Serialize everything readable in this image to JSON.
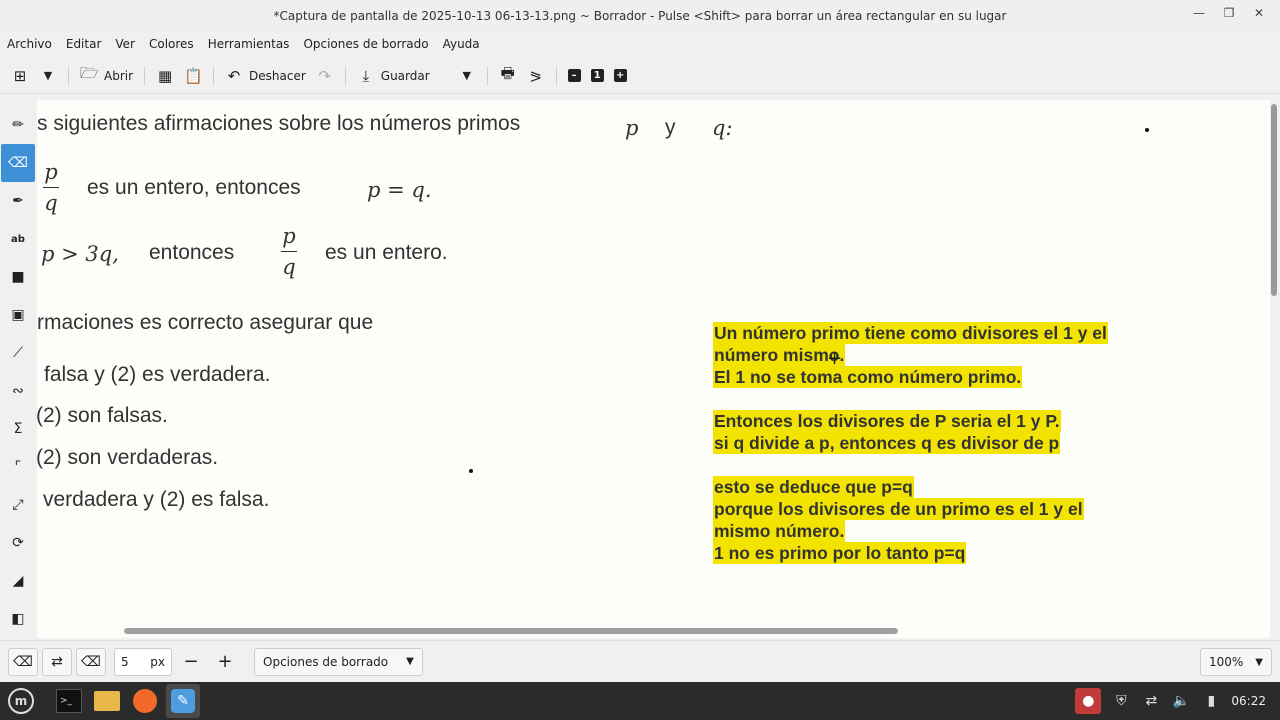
{
  "window": {
    "title": "*Captura de pantalla de 2025-10-13 06-13-13.png ~ Borrador - Pulse <Shift> para borrar un área rectangular en su lugar"
  },
  "menu": [
    "Archivo",
    "Editar",
    "Ver",
    "Colores",
    "Herramientas",
    "Opciones de borrado",
    "Ayuda"
  ],
  "toolbar": {
    "open_label": "Abrir",
    "undo_label": "Deshacer",
    "save_label": "Guardar"
  },
  "tools": [
    "pencil",
    "eraser",
    "highlighter",
    "text",
    "rectangle",
    "freeform-select",
    "line",
    "curve",
    "symmetry",
    "crop",
    "scale",
    "rotate",
    "skew",
    "filters"
  ],
  "document": {
    "line1": {
      "text": "s siguientes afirmaciones sobre los números primos",
      "p": "p",
      "y": "y",
      "q": "q:"
    },
    "line2": {
      "num": "p",
      "den": "q",
      "text": "es un entero, entonces",
      "eq": "p = q."
    },
    "line3": {
      "cond": "p > 3q,",
      "text": "entonces",
      "num": "p",
      "den": "q",
      "tail": "es un entero."
    },
    "line4": "rmaciones es correcto asegurar que",
    "options": [
      "falsa y (2) es verdadera.",
      "(2) son falsas.",
      "(2) son verdaderas.",
      "verdadera y (2) es falsa."
    ]
  },
  "annotation": {
    "lines": [
      "Un número primo tiene como divisores el 1 y el",
      "número mismo.",
      "El 1 no se toma como número primo.",
      "",
      "Entonces los divisores de P seria el 1 y P.",
      "si q divide a p, entonces q es divisor de p",
      "",
      "esto se deduce que p=q",
      "porque los divisores de un primo es el 1 y el",
      "mismo número.",
      "1 no es primo por lo tanto p=q"
    ],
    "highlight_color": "#f2e400"
  },
  "bottom": {
    "size_value": "5",
    "size_unit": "px",
    "options_label": "Opciones de borrado",
    "zoom": "100%"
  },
  "taskbar": {
    "clock": "06:22"
  }
}
